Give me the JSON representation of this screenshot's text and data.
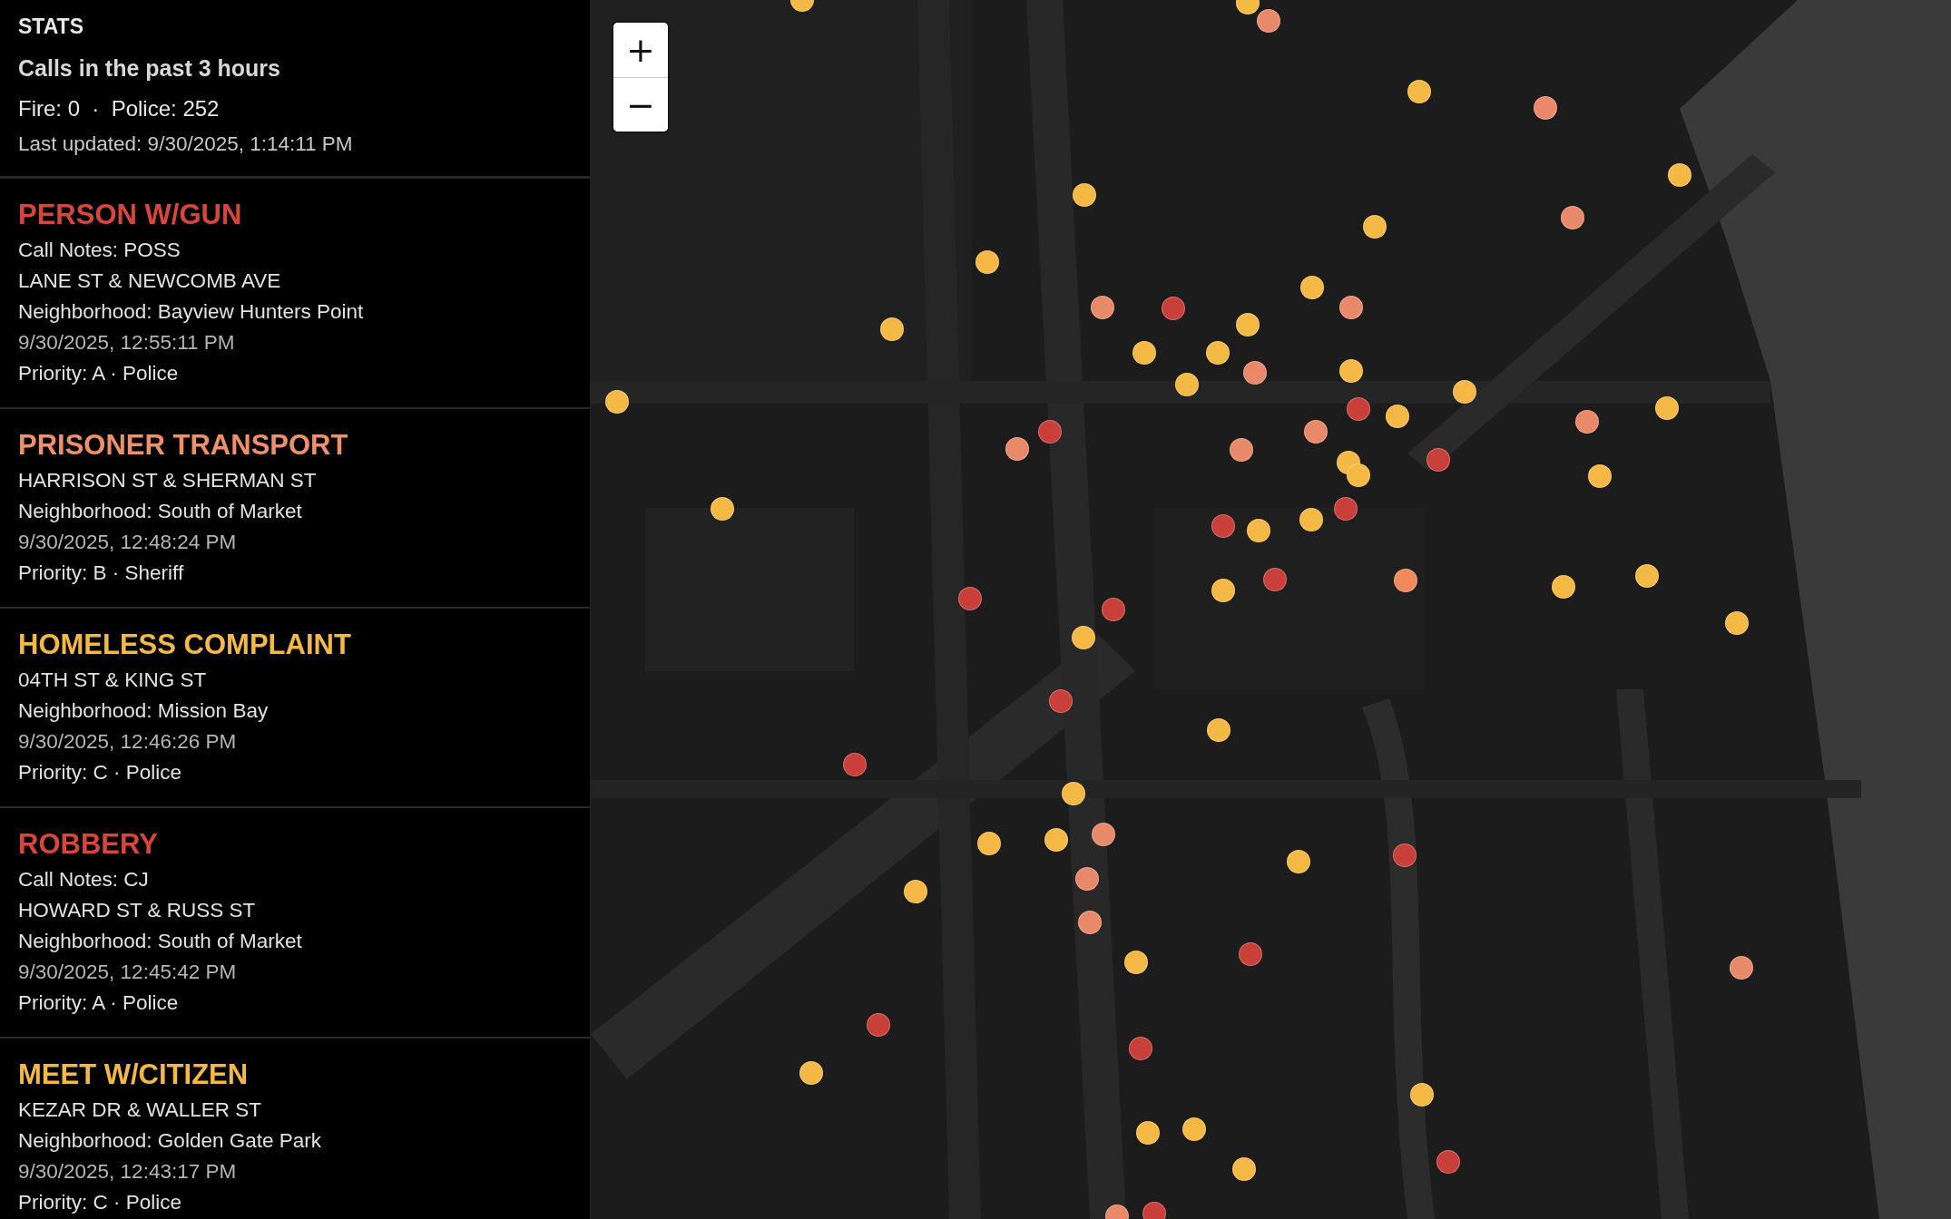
{
  "stats": {
    "heading": "STATS",
    "subheading": "Calls in the past 3 hours",
    "counts": "Fire: 0  ·  Police: 252",
    "updated": "Last updated: 9/30/2025, 1:14:11 PM"
  },
  "incidents": [
    {
      "title": "PERSON W/GUN",
      "color": "#d8453b",
      "notes": "Call Notes: POSS",
      "address": "LANE ST & NEWCOMB AVE",
      "neighborhood": "Neighborhood: Bayview Hunters Point",
      "time": "9/30/2025, 12:55:11 PM",
      "priority": "Priority: A · Police"
    },
    {
      "title": "PRISONER TRANSPORT",
      "color": "#ee9068",
      "address": "HARRISON ST & SHERMAN ST",
      "neighborhood": "Neighborhood: South of Market",
      "time": "9/30/2025, 12:48:24 PM",
      "priority": "Priority: B · Sheriff"
    },
    {
      "title": "HOMELESS COMPLAINT",
      "color": "#f4b844",
      "address": "04TH ST & KING ST",
      "neighborhood": "Neighborhood: Mission Bay",
      "time": "9/30/2025, 12:46:26 PM",
      "priority": "Priority: C · Police"
    },
    {
      "title": "ROBBERY",
      "color": "#d8453b",
      "notes": "Call Notes: CJ",
      "address": "HOWARD ST & RUSS ST",
      "neighborhood": "Neighborhood: South of Market",
      "time": "9/30/2025, 12:45:42 PM",
      "priority": "Priority: A · Police"
    },
    {
      "title": "MEET W/CITIZEN",
      "color": "#f4b844",
      "address": "KEZAR DR & WALLER ST",
      "neighborhood": "Neighborhood: Golden Gate Park",
      "time": "9/30/2025, 12:43:17 PM",
      "priority": "Priority: C · Police"
    }
  ],
  "map": {
    "zoom_in": "+",
    "zoom_out": "−",
    "markers": [
      {
        "color": "#f4b844"
      },
      {
        "color": "#f4b844"
      },
      {
        "color": "#e8896a"
      },
      {
        "color": "#f4b844"
      },
      {
        "color": "#e8896a"
      },
      {
        "color": "#f4b844"
      },
      {
        "color": "#f4b844"
      },
      {
        "color": "#f4b844"
      },
      {
        "color": "#e8896a"
      },
      {
        "color": "#f4b844"
      },
      {
        "color": "#f4b844"
      },
      {
        "color": "#e8896a"
      },
      {
        "color": "#c9403a"
      },
      {
        "color": "#e8896a"
      },
      {
        "color": "#f4b844"
      },
      {
        "color": "#f4b844"
      },
      {
        "color": "#f4b844"
      },
      {
        "color": "#f4b844"
      },
      {
        "color": "#e8896a"
      },
      {
        "color": "#f4b844"
      },
      {
        "color": "#f4b844"
      },
      {
        "color": "#f4b844"
      },
      {
        "color": "#c9403a"
      },
      {
        "color": "#f4b844"
      },
      {
        "color": "#f4b844"
      },
      {
        "color": "#f4b844"
      },
      {
        "color": "#c9403a"
      },
      {
        "color": "#e8896a"
      },
      {
        "color": "#e8896a"
      },
      {
        "color": "#e8896a"
      },
      {
        "color": "#e8896a"
      },
      {
        "color": "#c9403a"
      },
      {
        "color": "#f4b844"
      },
      {
        "color": "#f4b844"
      },
      {
        "color": "#f4b844"
      },
      {
        "color": "#f4b844"
      },
      {
        "color": "#c9403a"
      },
      {
        "color": "#f4b844"
      },
      {
        "color": "#c9403a"
      },
      {
        "color": "#f4b844"
      },
      {
        "color": "#c9403a"
      },
      {
        "color": "#f08a5a"
      },
      {
        "color": "#f4b844"
      },
      {
        "color": "#f4b844"
      },
      {
        "color": "#f4b844"
      },
      {
        "color": "#c9403a"
      },
      {
        "color": "#c9403a"
      },
      {
        "color": "#f4b844"
      },
      {
        "color": "#f4b844"
      },
      {
        "color": "#c9403a"
      },
      {
        "color": "#f4b844"
      },
      {
        "color": "#c9403a"
      },
      {
        "color": "#f4b844"
      },
      {
        "color": "#e8896a"
      },
      {
        "color": "#f4b844"
      },
      {
        "color": "#f4b844"
      },
      {
        "color": "#e8896a"
      },
      {
        "color": "#c9403a"
      },
      {
        "color": "#f4b844"
      },
      {
        "color": "#f4b844"
      },
      {
        "color": "#e8896a"
      },
      {
        "color": "#f4b844"
      },
      {
        "color": "#c9403a"
      },
      {
        "color": "#e8896a"
      },
      {
        "color": "#c9403a"
      },
      {
        "color": "#c9403a"
      },
      {
        "color": "#f4b844"
      },
      {
        "color": "#f4b844"
      },
      {
        "color": "#f4b844"
      },
      {
        "color": "#f4b844"
      },
      {
        "color": "#f4b844"
      },
      {
        "color": "#c9403a"
      },
      {
        "color": "#e8896a"
      },
      {
        "color": "#c9403a"
      }
    ]
  }
}
